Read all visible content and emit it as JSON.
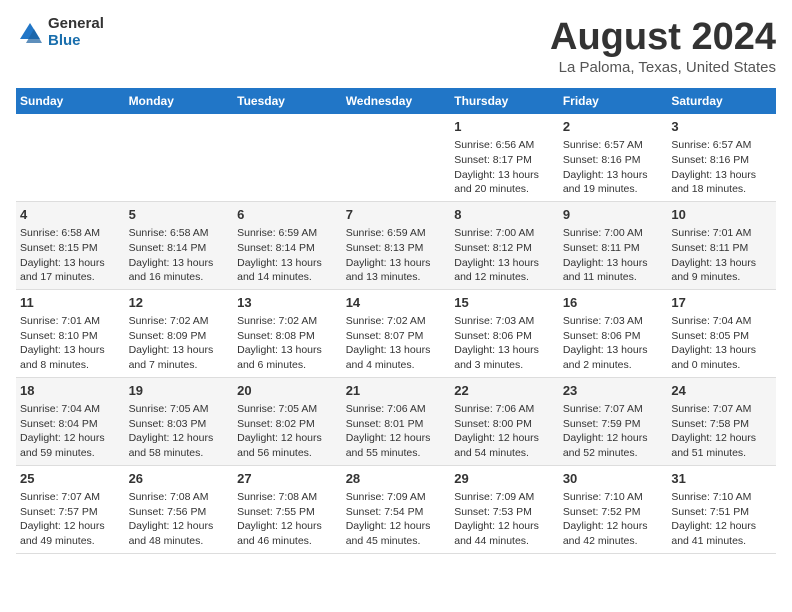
{
  "logo": {
    "general": "General",
    "blue": "Blue"
  },
  "title": "August 2024",
  "subtitle": "La Paloma, Texas, United States",
  "days_of_week": [
    "Sunday",
    "Monday",
    "Tuesday",
    "Wednesday",
    "Thursday",
    "Friday",
    "Saturday"
  ],
  "weeks": [
    [
      {
        "day": "",
        "info": ""
      },
      {
        "day": "",
        "info": ""
      },
      {
        "day": "",
        "info": ""
      },
      {
        "day": "",
        "info": ""
      },
      {
        "day": "1",
        "info": "Sunrise: 6:56 AM\nSunset: 8:17 PM\nDaylight: 13 hours\nand 20 minutes."
      },
      {
        "day": "2",
        "info": "Sunrise: 6:57 AM\nSunset: 8:16 PM\nDaylight: 13 hours\nand 19 minutes."
      },
      {
        "day": "3",
        "info": "Sunrise: 6:57 AM\nSunset: 8:16 PM\nDaylight: 13 hours\nand 18 minutes."
      }
    ],
    [
      {
        "day": "4",
        "info": "Sunrise: 6:58 AM\nSunset: 8:15 PM\nDaylight: 13 hours\nand 17 minutes."
      },
      {
        "day": "5",
        "info": "Sunrise: 6:58 AM\nSunset: 8:14 PM\nDaylight: 13 hours\nand 16 minutes."
      },
      {
        "day": "6",
        "info": "Sunrise: 6:59 AM\nSunset: 8:14 PM\nDaylight: 13 hours\nand 14 minutes."
      },
      {
        "day": "7",
        "info": "Sunrise: 6:59 AM\nSunset: 8:13 PM\nDaylight: 13 hours\nand 13 minutes."
      },
      {
        "day": "8",
        "info": "Sunrise: 7:00 AM\nSunset: 8:12 PM\nDaylight: 13 hours\nand 12 minutes."
      },
      {
        "day": "9",
        "info": "Sunrise: 7:00 AM\nSunset: 8:11 PM\nDaylight: 13 hours\nand 11 minutes."
      },
      {
        "day": "10",
        "info": "Sunrise: 7:01 AM\nSunset: 8:11 PM\nDaylight: 13 hours\nand 9 minutes."
      }
    ],
    [
      {
        "day": "11",
        "info": "Sunrise: 7:01 AM\nSunset: 8:10 PM\nDaylight: 13 hours\nand 8 minutes."
      },
      {
        "day": "12",
        "info": "Sunrise: 7:02 AM\nSunset: 8:09 PM\nDaylight: 13 hours\nand 7 minutes."
      },
      {
        "day": "13",
        "info": "Sunrise: 7:02 AM\nSunset: 8:08 PM\nDaylight: 13 hours\nand 6 minutes."
      },
      {
        "day": "14",
        "info": "Sunrise: 7:02 AM\nSunset: 8:07 PM\nDaylight: 13 hours\nand 4 minutes."
      },
      {
        "day": "15",
        "info": "Sunrise: 7:03 AM\nSunset: 8:06 PM\nDaylight: 13 hours\nand 3 minutes."
      },
      {
        "day": "16",
        "info": "Sunrise: 7:03 AM\nSunset: 8:06 PM\nDaylight: 13 hours\nand 2 minutes."
      },
      {
        "day": "17",
        "info": "Sunrise: 7:04 AM\nSunset: 8:05 PM\nDaylight: 13 hours\nand 0 minutes."
      }
    ],
    [
      {
        "day": "18",
        "info": "Sunrise: 7:04 AM\nSunset: 8:04 PM\nDaylight: 12 hours\nand 59 minutes."
      },
      {
        "day": "19",
        "info": "Sunrise: 7:05 AM\nSunset: 8:03 PM\nDaylight: 12 hours\nand 58 minutes."
      },
      {
        "day": "20",
        "info": "Sunrise: 7:05 AM\nSunset: 8:02 PM\nDaylight: 12 hours\nand 56 minutes."
      },
      {
        "day": "21",
        "info": "Sunrise: 7:06 AM\nSunset: 8:01 PM\nDaylight: 12 hours\nand 55 minutes."
      },
      {
        "day": "22",
        "info": "Sunrise: 7:06 AM\nSunset: 8:00 PM\nDaylight: 12 hours\nand 54 minutes."
      },
      {
        "day": "23",
        "info": "Sunrise: 7:07 AM\nSunset: 7:59 PM\nDaylight: 12 hours\nand 52 minutes."
      },
      {
        "day": "24",
        "info": "Sunrise: 7:07 AM\nSunset: 7:58 PM\nDaylight: 12 hours\nand 51 minutes."
      }
    ],
    [
      {
        "day": "25",
        "info": "Sunrise: 7:07 AM\nSunset: 7:57 PM\nDaylight: 12 hours\nand 49 minutes."
      },
      {
        "day": "26",
        "info": "Sunrise: 7:08 AM\nSunset: 7:56 PM\nDaylight: 12 hours\nand 48 minutes."
      },
      {
        "day": "27",
        "info": "Sunrise: 7:08 AM\nSunset: 7:55 PM\nDaylight: 12 hours\nand 46 minutes."
      },
      {
        "day": "28",
        "info": "Sunrise: 7:09 AM\nSunset: 7:54 PM\nDaylight: 12 hours\nand 45 minutes."
      },
      {
        "day": "29",
        "info": "Sunrise: 7:09 AM\nSunset: 7:53 PM\nDaylight: 12 hours\nand 44 minutes."
      },
      {
        "day": "30",
        "info": "Sunrise: 7:10 AM\nSunset: 7:52 PM\nDaylight: 12 hours\nand 42 minutes."
      },
      {
        "day": "31",
        "info": "Sunrise: 7:10 AM\nSunset: 7:51 PM\nDaylight: 12 hours\nand 41 minutes."
      }
    ]
  ]
}
